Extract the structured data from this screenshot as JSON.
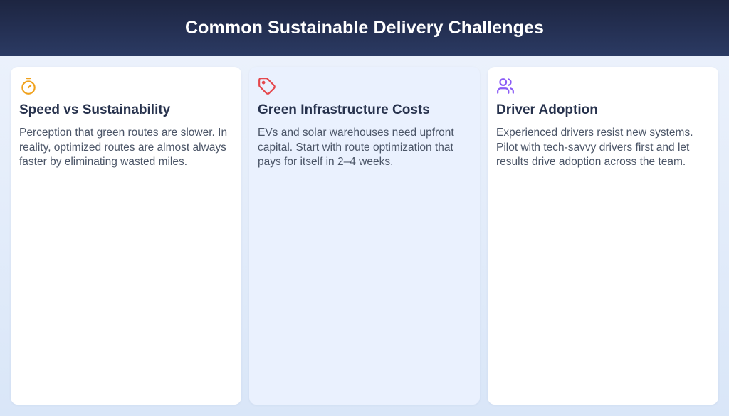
{
  "header": {
    "title": "Common Sustainable Delivery Challenges"
  },
  "cards": [
    {
      "icon": "stopwatch-icon",
      "icon_color": "#f0a11b",
      "title": "Speed vs Sustainability",
      "body": "Perception that green routes are slower. In reality, optimized routes are almost always faster by eliminating wasted miles."
    },
    {
      "icon": "tag-icon",
      "icon_color": "#e5484d",
      "title": "Green Infrastructure Costs",
      "body": "EVs and solar warehouses need upfront capital. Start with route optimization that pays for itself in 2–4 weeks."
    },
    {
      "icon": "users-icon",
      "icon_color": "#8b5cf6",
      "title": "Driver Adoption",
      "body": "Experienced drivers resist new systems. Pilot with tech-savvy drivers first and let results drive adoption across the team."
    }
  ]
}
